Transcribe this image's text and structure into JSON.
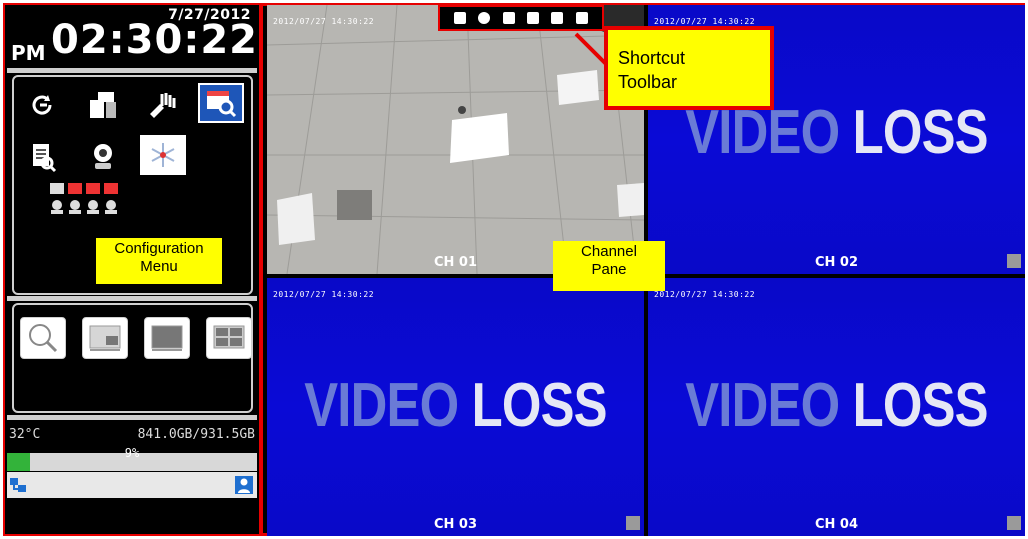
{
  "datetime": {
    "date": "7/27/2012",
    "ampm": "PM",
    "time": "02:30:22"
  },
  "status": {
    "temperature": "32°C",
    "disk": "841.0GB/931.5GB",
    "percent": "9%",
    "used_fraction": 0.09
  },
  "labels": {
    "config_line1": "Configuration",
    "config_line2": "Menu",
    "channel_line1": "Channel",
    "channel_line2": "Pane",
    "shortcut_line1": "Shortcut",
    "shortcut_line2": "Toolbar"
  },
  "channels": [
    {
      "name": "CH 01",
      "timestamp": "2012/07/27  14:30:22",
      "signal": "live"
    },
    {
      "name": "CH 02",
      "timestamp": "2012/07/27  14:30:22",
      "signal": "VIDEO LOSS",
      "loss_word1": "VIDEO",
      "loss_word2": "LOSS"
    },
    {
      "name": "CH 03",
      "timestamp": "2012/07/27  14:30:22",
      "signal": "VIDEO LOSS",
      "loss_word1": "VIDEO",
      "loss_word2": "LOSS"
    },
    {
      "name": "CH 04",
      "timestamp": "2012/07/27  14:30:22",
      "signal": "VIDEO LOSS",
      "loss_word1": "VIDEO",
      "loss_word2": "LOSS"
    }
  ],
  "colors": {
    "frame": "#e60000",
    "label_bg": "#ffff00",
    "video_loss_bg": "#0a0ad6",
    "selected_icon_bg": "#1e56b8",
    "progress": "#33b33a"
  }
}
